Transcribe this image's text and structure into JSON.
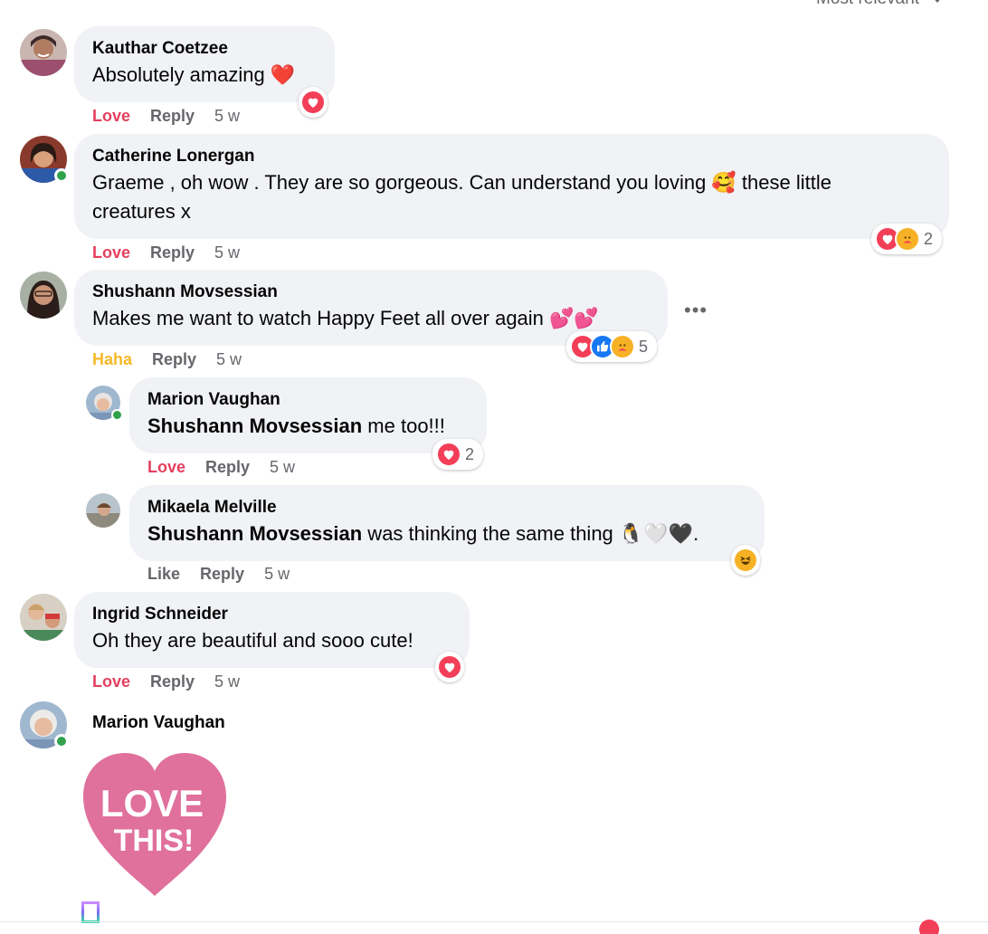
{
  "sort": {
    "label": "Most relevant"
  },
  "colors": {
    "love": "#e4405f",
    "haha": "#f7b928",
    "bubble": "#f0f2f5",
    "secondary": "#65676b",
    "online": "#31a24c",
    "sticker_pink": "#e0709c"
  },
  "comments": [
    {
      "author": "Kauthar Coetzee",
      "text": "Absolutely amazing ❤️",
      "actions": {
        "reaction": "Love",
        "reply": "Reply",
        "time": "5 w"
      },
      "reactions": {
        "icons": [
          "heart-icon"
        ],
        "count": ""
      }
    },
    {
      "author": "Catherine Lonergan",
      "text_line1": "Graeme , oh wow . They are so gorgeous. Can understand you loving 🥰   these little",
      "text_line2": "creatures x",
      "actions": {
        "reaction": "Love",
        "reply": "Reply",
        "time": "5 w"
      },
      "reactions": {
        "icons": [
          "heart-icon",
          "care-icon"
        ],
        "count": "2"
      }
    },
    {
      "author": "Shushann Movsessian",
      "text": "Makes me want to watch Happy Feet all over again 💕💕",
      "actions": {
        "reaction": "Haha",
        "reply": "Reply",
        "time": "5 w"
      },
      "reactions": {
        "icons": [
          "heart-icon",
          "like-icon",
          "care-icon"
        ],
        "count": "5"
      },
      "more": "•••"
    }
  ],
  "replies": [
    {
      "author": "Marion Vaughan",
      "mention": "Shushann Movsessian",
      "text": " me too!!!",
      "actions": {
        "reaction": "Love",
        "reply": "Reply",
        "time": "5 w"
      },
      "reactions": {
        "icons": [
          "heart-icon"
        ],
        "count": "2"
      }
    },
    {
      "author": "Mikaela Melville",
      "mention": "Shushann Movsessian",
      "text": " was thinking the same thing 🐧🤍🖤.",
      "actions": {
        "reaction": "Like",
        "reply": "Reply",
        "time": "5 w"
      },
      "reactions": {
        "icons": [
          "haha-icon"
        ],
        "count": ""
      }
    }
  ],
  "comments2": [
    {
      "author": "Ingrid Schneider",
      "text": "Oh they are beautiful and sooo cute!",
      "actions": {
        "reaction": "Love",
        "reply": "Reply",
        "time": "5 w"
      },
      "reactions": {
        "icons": [
          "heart-icon"
        ],
        "count": ""
      }
    },
    {
      "author": "Marion Vaughan",
      "sticker": {
        "line1": "LOVE",
        "line2": "THIS!"
      }
    }
  ]
}
